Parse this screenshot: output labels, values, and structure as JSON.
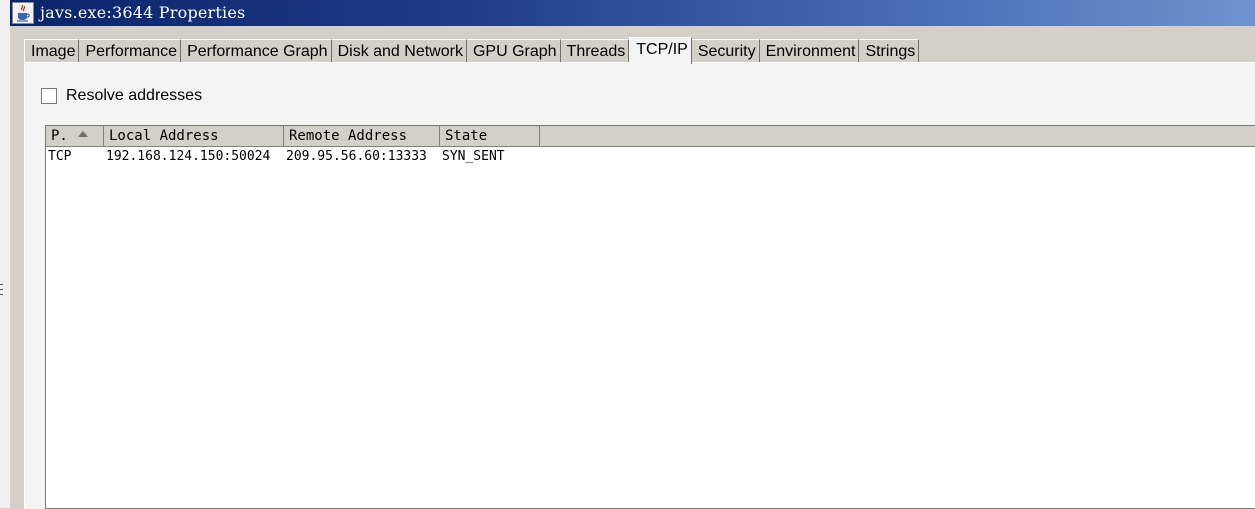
{
  "window": {
    "title": "javs.exe:3644 Properties",
    "icon": "java-cup-icon"
  },
  "tabs": [
    {
      "label": "Image",
      "active": false
    },
    {
      "label": "Performance",
      "active": false
    },
    {
      "label": "Performance Graph",
      "active": false
    },
    {
      "label": "Disk and Network",
      "active": false
    },
    {
      "label": "GPU Graph",
      "active": false
    },
    {
      "label": "Threads",
      "active": false
    },
    {
      "label": "TCP/IP",
      "active": true
    },
    {
      "label": "Security",
      "active": false
    },
    {
      "label": "Environment",
      "active": false
    },
    {
      "label": "Strings",
      "active": false
    }
  ],
  "options": {
    "resolve_addresses_label": "Resolve addresses",
    "resolve_addresses_checked": false
  },
  "table": {
    "columns": [
      "P.",
      "Local Address",
      "Remote Address",
      "State"
    ],
    "sort_column": "P.",
    "sort_direction": "ascending",
    "rows": [
      [
        "TCP",
        "192.168.124.150:50024",
        "209.95.56.60:13333",
        "SYN_SENT"
      ]
    ]
  },
  "colors": {
    "titlebar_start": "#0a246a",
    "titlebar_end": "#6f92cf",
    "dialog_face": "#d4d0c8"
  }
}
